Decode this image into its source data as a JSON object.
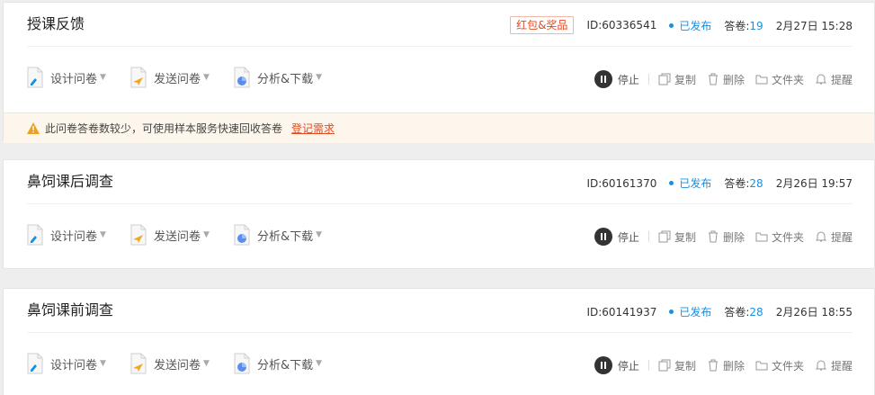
{
  "colors": {
    "accent_blue": "#1a8fe0",
    "tag_red": "#e24a1f",
    "notice_bg": "#fdf6ec",
    "warn_orange": "#f0a020"
  },
  "tools": {
    "design": "设计问卷",
    "send": "发送问卷",
    "analyze": "分析&下载"
  },
  "actions": {
    "stop": "停止",
    "copy": "复制",
    "delete": "删除",
    "folder": "文件夹",
    "remind": "提醒"
  },
  "labels": {
    "answers": "答卷:",
    "published": "已发布"
  },
  "cards": [
    {
      "title": "授课反馈",
      "tag": "红包&奖品",
      "id": "ID:60336541",
      "status": "已发布",
      "answer_count": "19",
      "date": "2月27日 15:28",
      "notice": "此问卷答卷数较少，可使用样本服务快速回收答卷",
      "notice_link": "登记需求"
    },
    {
      "title": "鼻饲课后调查",
      "id": "ID:60161370",
      "status": "已发布",
      "answer_count": "28",
      "date": "2月26日 19:57"
    },
    {
      "title": "鼻饲课前调查",
      "id": "ID:60141937",
      "status": "已发布",
      "answer_count": "28",
      "date": "2月26日 18:55"
    }
  ]
}
